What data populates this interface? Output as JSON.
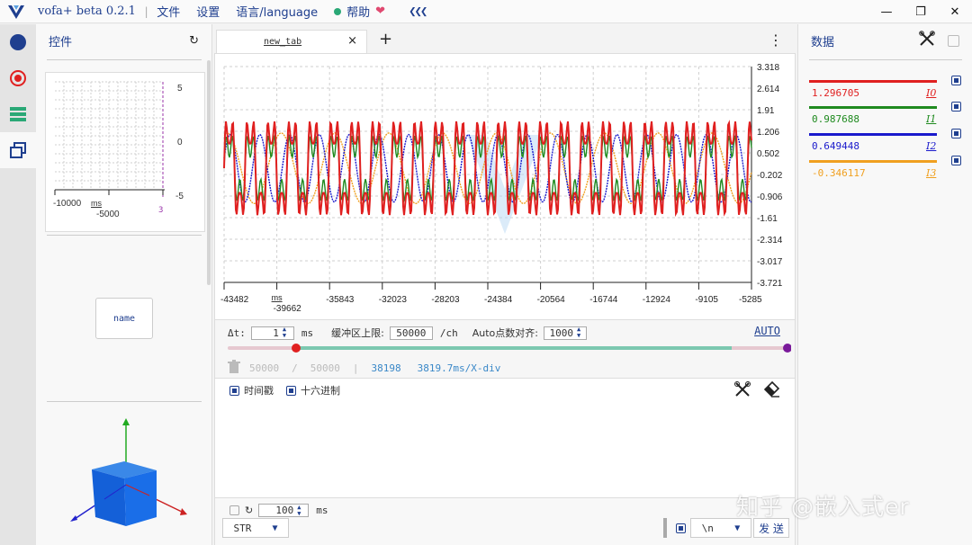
{
  "titlebar": {
    "app_title": "vofa+ beta 0.2.1",
    "separator": "|",
    "menus": [
      "文件",
      "设置",
      "语言/language"
    ],
    "help": "帮助",
    "collapse": "«"
  },
  "left_panel": {
    "title": "控件",
    "mini_plot": {
      "x_ticks": [
        "-10000",
        "-5000"
      ],
      "x_unit": "ms",
      "y_ticks": [
        "5",
        "0",
        "-5"
      ],
      "marker": "3"
    },
    "name_button": "name"
  },
  "tabs": {
    "active": "new_tab",
    "close": "×",
    "add": "+",
    "more": "⋮"
  },
  "plot": {
    "y_ticks": [
      "3.318",
      "2.614",
      "1.91",
      "1.206",
      "0.502",
      "-0.202",
      "-0.906",
      "-1.61",
      "-2.314",
      "-3.017",
      "-3.721"
    ],
    "x_ticks": [
      "-43482",
      "-39662",
      "-35843",
      "-32023",
      "-28203",
      "-24384",
      "-20564",
      "-16744",
      "-12924",
      "-9105",
      "-5285"
    ],
    "x_unit": "ms",
    "colors": {
      "I0": "#e02020",
      "I1": "#1f8a1f",
      "I2": "#1a1acc",
      "I3": "#f0a020"
    }
  },
  "controls": {
    "dt_label": "Δt:",
    "dt_value": "1",
    "dt_unit": "ms",
    "buffer_label": "缓冲区上限:",
    "buffer_value": "50000",
    "buffer_unit": "/ch",
    "align_label": "Auto点数对齐:",
    "align_value": "1000",
    "auto": "AUTO",
    "stat_total": "50000",
    "stat_slash": "/",
    "stat_total2": "50000",
    "stat_bar": "|",
    "stat_count": "38198",
    "stat_div": "3819.7ms/X-div"
  },
  "recv": {
    "timestamp": "时间戳",
    "hex": "十六进制"
  },
  "send": {
    "interval": "100",
    "interval_unit": "ms",
    "format": "STR",
    "line_end": "\\n",
    "send_btn": "发 送"
  },
  "right_panel": {
    "title": "数据",
    "channels": [
      {
        "value": "1.296705",
        "name": "I0",
        "color": "#e02020"
      },
      {
        "value": "0.987688",
        "name": "I1",
        "color": "#1f8a1f"
      },
      {
        "value": "0.649448",
        "name": "I2",
        "color": "#1a1acc"
      },
      {
        "value": "-0.346117",
        "name": "I3",
        "color": "#f0a020"
      }
    ]
  },
  "watermark": "知乎 @嵌入式er",
  "window": {
    "minimize": "—",
    "restore": "❐",
    "close": "✕"
  }
}
